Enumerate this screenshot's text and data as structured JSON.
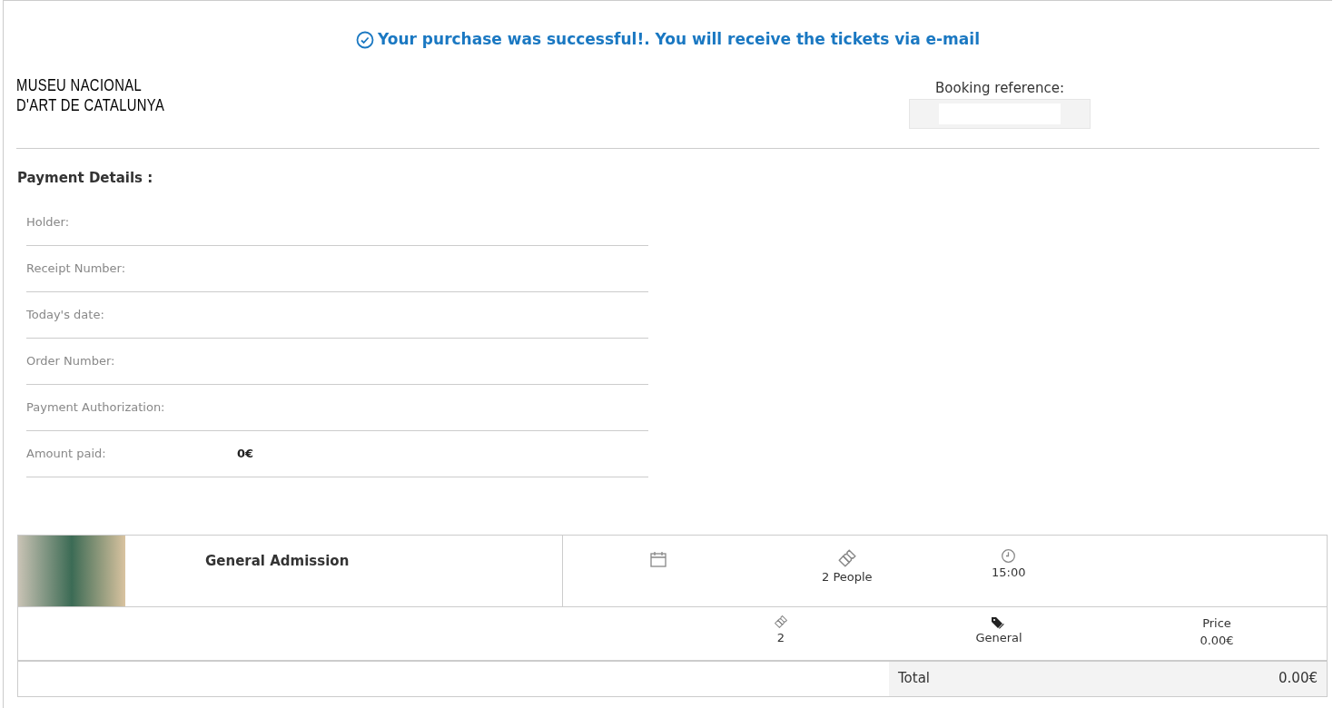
{
  "success_message": "Your purchase was successful!. You will receive the tickets via e-mail",
  "logo": {
    "line_1": "MUSEU NACIONAL",
    "line_2": "D'ART DE CATALUNYA"
  },
  "booking_reference": {
    "label": "Booking reference:"
  },
  "payment_details": {
    "title": "Payment Details :",
    "rows": [
      {
        "label": "Holder:"
      },
      {
        "label": "Receipt Number:"
      },
      {
        "label": "Today's date:"
      },
      {
        "label": "Order Number:"
      },
      {
        "label": "Payment Authorization:"
      },
      {
        "label": "Amount paid:",
        "value": "0€"
      }
    ]
  },
  "ticket": {
    "title": "General Admission",
    "people": "2 People",
    "time": "15:00",
    "line": {
      "quantity": "2",
      "rate": "General",
      "price_label": "Price",
      "price": "0.00€"
    },
    "total_label": "Total",
    "total": "0.00€"
  }
}
